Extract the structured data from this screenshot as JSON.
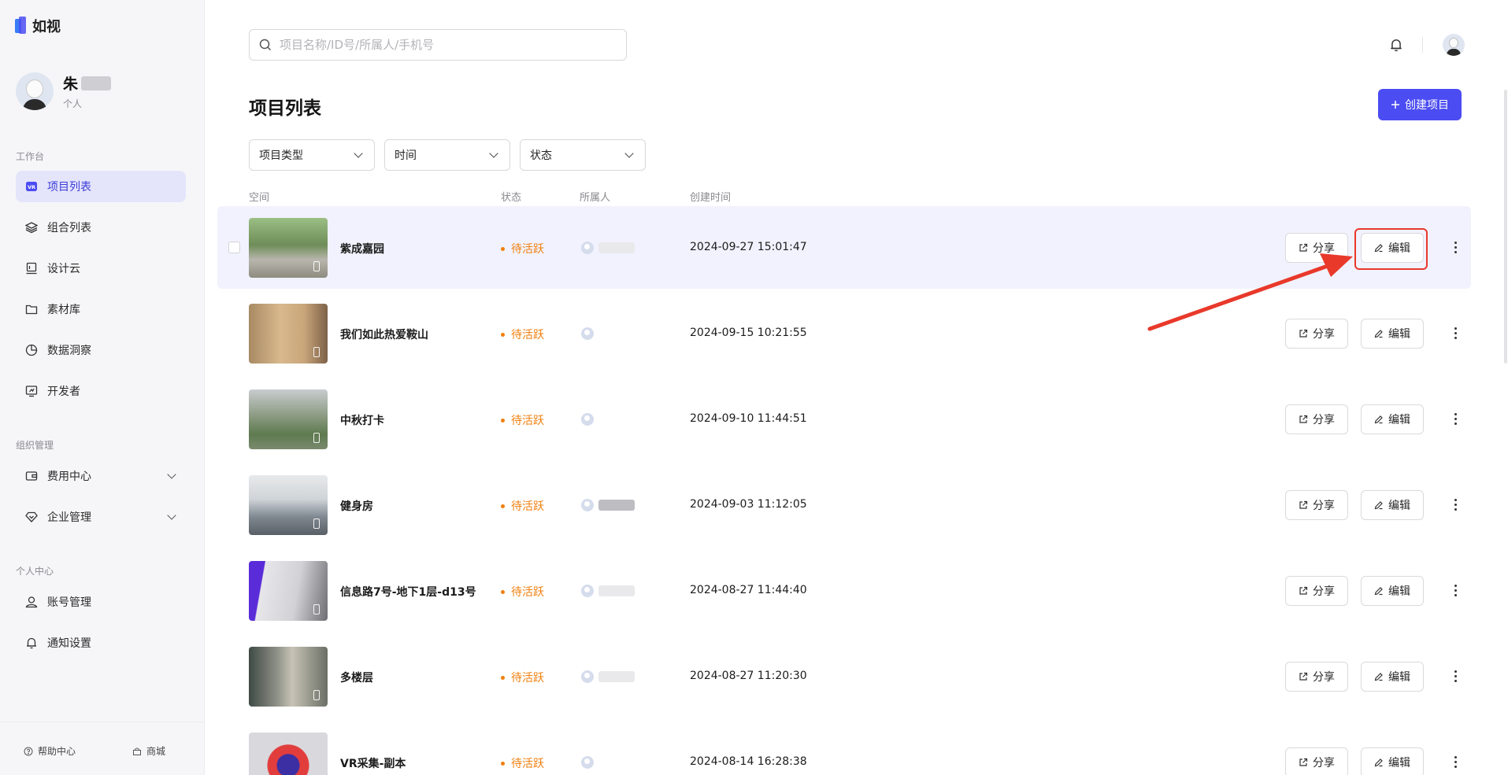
{
  "app": {
    "name": "如视"
  },
  "user": {
    "name": "朱",
    "role": "个人"
  },
  "sidebar": {
    "workbench_title": "工作台",
    "workbench": [
      {
        "label": "项目列表",
        "icon": "vr-icon",
        "active": true
      },
      {
        "label": "组合列表",
        "icon": "layers-icon"
      },
      {
        "label": "设计云",
        "icon": "design-icon"
      },
      {
        "label": "素材库",
        "icon": "folder-icon"
      },
      {
        "label": "数据洞察",
        "icon": "pie-chart-icon"
      },
      {
        "label": "开发者",
        "icon": "developer-icon"
      }
    ],
    "org_title": "组织管理",
    "org": [
      {
        "label": "费用中心",
        "icon": "wallet-icon"
      },
      {
        "label": "企业管理",
        "icon": "diamond-icon"
      }
    ],
    "personal_title": "个人中心",
    "personal": [
      {
        "label": "账号管理",
        "icon": "user-icon"
      },
      {
        "label": "通知设置",
        "icon": "bell-icon"
      }
    ],
    "footer": {
      "help": "帮助中心",
      "shop": "商城"
    }
  },
  "search": {
    "placeholder": "项目名称/ID号/所属人/手机号",
    "value": ""
  },
  "page": {
    "title": "项目列表",
    "create_label": "创建项目"
  },
  "filters": [
    "项目类型",
    "时间",
    "状态"
  ],
  "table": {
    "headers": {
      "space": "空间",
      "status": "状态",
      "owner": "所属人",
      "created": "创建时间"
    },
    "share_label": "分享",
    "edit_label": "编辑",
    "rows": [
      {
        "name": "紫成嘉园",
        "status": "待活跃",
        "created": "2024-09-27 15:01:47"
      },
      {
        "name": "我们如此热爱鞍山",
        "status": "待活跃",
        "created": "2024-09-15 10:21:55"
      },
      {
        "name": "中秋打卡",
        "status": "待活跃",
        "created": "2024-09-10 11:44:51"
      },
      {
        "name": "健身房",
        "status": "待活跃",
        "created": "2024-09-03 11:12:05"
      },
      {
        "name": "信息路7号-地下1层-d13号",
        "status": "待活跃",
        "created": "2024-08-27 11:44:40"
      },
      {
        "name": "多楼层",
        "status": "待活跃",
        "created": "2024-08-27 11:20:30"
      },
      {
        "name": "VR采集-副本",
        "status": "待活跃",
        "created": "2024-08-14 16:28:38"
      }
    ]
  },
  "colors": {
    "accent": "#4b4cf2",
    "status": "#f07f0e",
    "highlight": "#e8392b"
  }
}
